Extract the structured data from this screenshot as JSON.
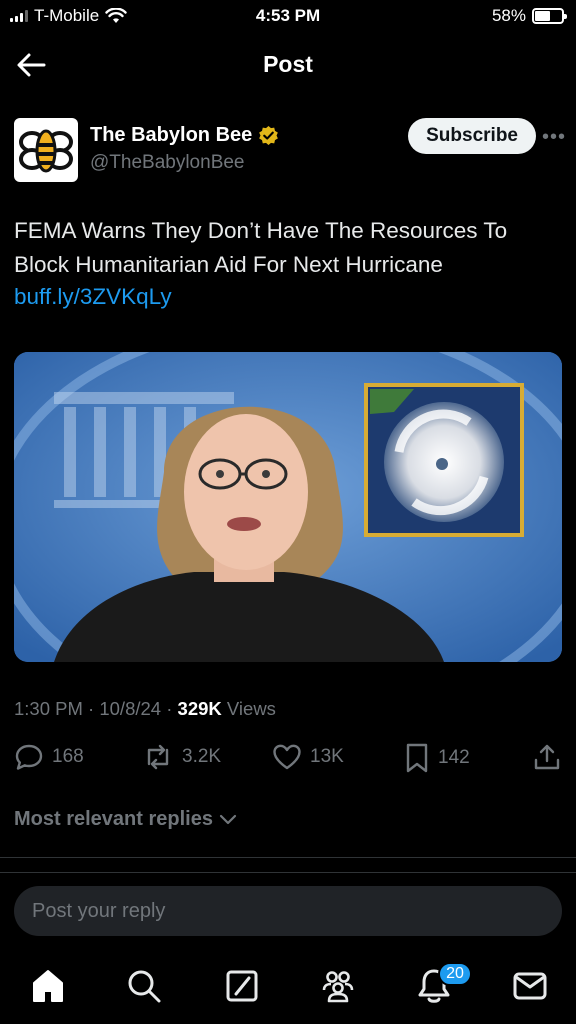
{
  "status_bar": {
    "carrier": "T-Mobile",
    "time": "4:53 PM",
    "battery_percent": "58%",
    "battery_level": 0.58
  },
  "header": {
    "title": "Post"
  },
  "author": {
    "name": "The Babylon Bee",
    "handle": "@TheBabylonBee",
    "verified": true,
    "subscribe_label": "Subscribe"
  },
  "post": {
    "text": "FEMA Warns They Don’t Have The Resources To Block Humanitarian Aid For Next Hurricane",
    "link": "buff.ly/3ZVKqLy",
    "time": "1:30 PM",
    "date": "10/8/24",
    "views_count": "329K",
    "views_label": "Views",
    "separator": "·"
  },
  "actions": {
    "replies": "168",
    "reposts": "3.2K",
    "likes": "13K",
    "bookmarks": "142"
  },
  "replies": {
    "filter_label": "Most relevant replies",
    "reply_placeholder": "Post your reply"
  },
  "tabbar": {
    "notifications_badge": "20"
  },
  "colors": {
    "accent": "#1d9bf0",
    "verified": "#e2b719",
    "background": "#000000"
  }
}
